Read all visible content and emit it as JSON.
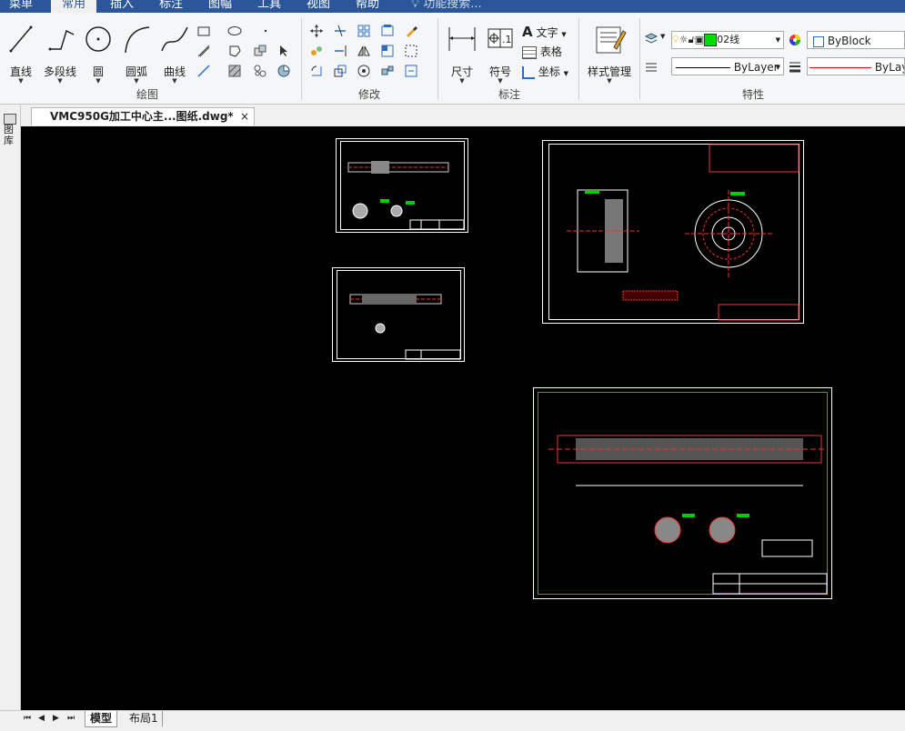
{
  "menubar": {
    "items": [
      "菜单",
      "常用",
      "插入",
      "标注",
      "图幅",
      "工具",
      "视图",
      "帮助"
    ],
    "active": "常用",
    "search_placeholder": "功能搜索..."
  },
  "ribbon": {
    "draw": {
      "label": "绘图",
      "buttons": [
        "直线",
        "多段线",
        "圆",
        "圆弧",
        "曲线"
      ]
    },
    "modify": {
      "label": "修改"
    },
    "annotate": {
      "label": "标注",
      "buttons": [
        "尺寸",
        "符号"
      ],
      "small": [
        "文字",
        "表格",
        "坐标"
      ]
    },
    "style": {
      "button": "样式管理"
    },
    "properties": {
      "label": "特性",
      "layer_value": "02线",
      "color_value": "ByBlock",
      "linetype_value": "ByLayer",
      "lineweight_value": "ByLay"
    },
    "colors": {
      "green": "#00dd00"
    }
  },
  "document": {
    "tab_title": "VMC950G加工中心主...图纸.dwg*",
    "close_symbol": "×"
  },
  "left_panel": {
    "label": "图库"
  },
  "layout_tabs": {
    "nav": [
      "⏮",
      "◀",
      "▶",
      "⏭"
    ],
    "tabs": [
      "模型",
      "布局1"
    ],
    "active": "模型"
  }
}
